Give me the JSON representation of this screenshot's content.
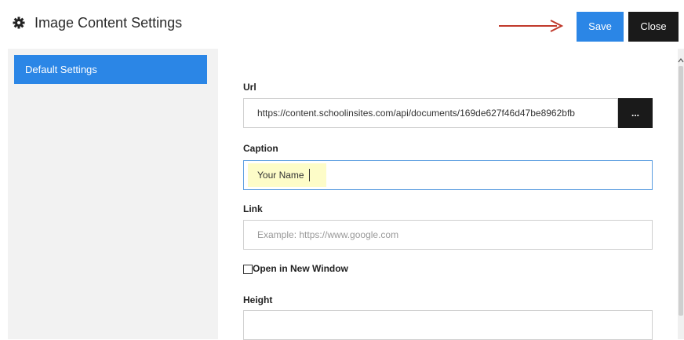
{
  "header": {
    "title": "Image Content Settings",
    "save_label": "Save",
    "close_label": "Close"
  },
  "sidebar": {
    "items": [
      {
        "label": "Default Settings",
        "active": true
      }
    ]
  },
  "form": {
    "url": {
      "label": "Url",
      "value": "https://content.schoolinsites.com/api/documents/169de627f46d47be8962bfb",
      "browse_label": "..."
    },
    "caption": {
      "label": "Caption",
      "value": "Your Name"
    },
    "link": {
      "label": "Link",
      "value": "",
      "placeholder": "Example: https://www.google.com"
    },
    "open_new_window": {
      "label": "Open in New Window",
      "checked": false
    },
    "height": {
      "label": "Height",
      "value": ""
    }
  },
  "colors": {
    "accent": "#2b86e6",
    "dark_button": "#1a1a1a",
    "arrow": "#c0392b",
    "caption_highlight": "#fdfcc8"
  },
  "icons": {
    "header": "gear-icon",
    "annotation": "arrow-right-icon"
  }
}
